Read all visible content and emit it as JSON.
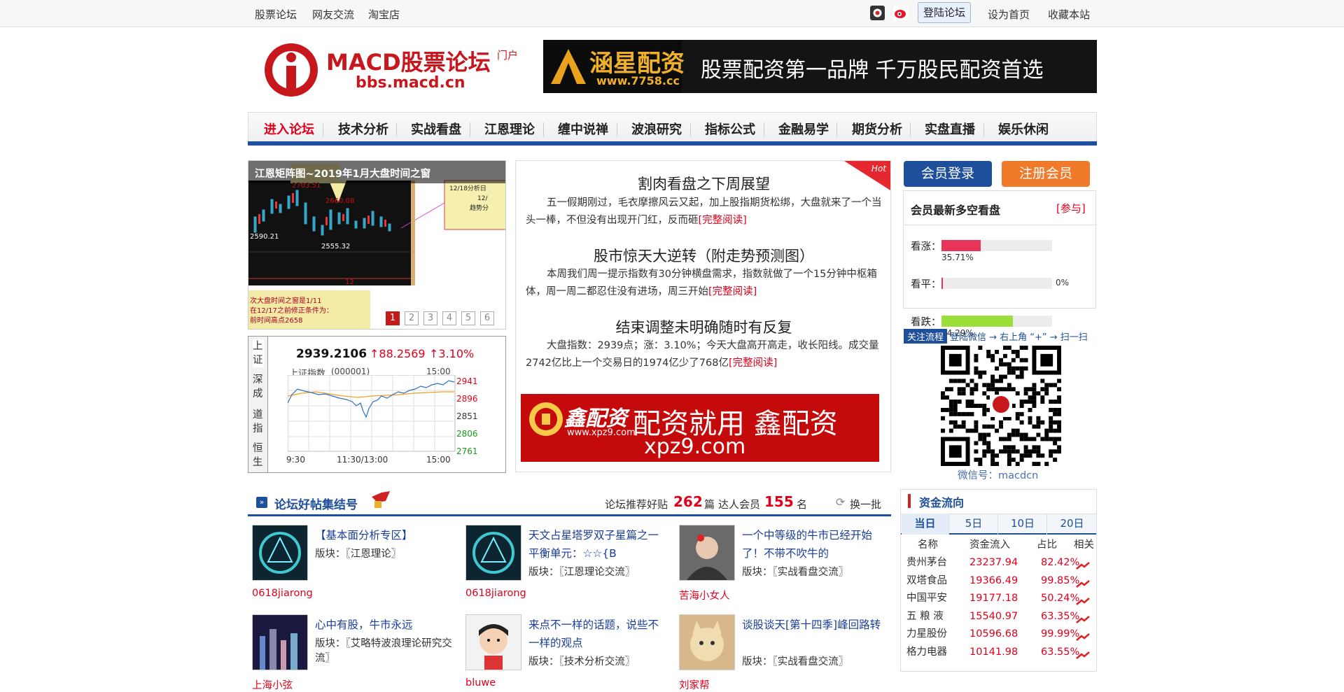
{
  "topbar": {
    "links": [
      "股票论坛",
      "网友交流",
      "淘宝店"
    ],
    "login": "登陆论坛",
    "set_home": "设为首页",
    "bookmark": "收藏本站"
  },
  "logo": {
    "title": "MACD股票论坛",
    "suffix": "门户",
    "url": "bbs.macd.cn"
  },
  "banner_top": {
    "brand": "涵星配资",
    "url": "www.7758.cc",
    "slogan": "股票配资第一品牌 千万股民配资首选"
  },
  "nav": [
    "进入论坛",
    "技术分析",
    "实战看盘",
    "江恩理论",
    "缠中说禅",
    "波浪研究",
    "指标公式",
    "金融易学",
    "期货分析",
    "实盘直播",
    "娱乐休闲"
  ],
  "slide": {
    "caption": "江恩矩阵图~2019年1月大盘时间之窗",
    "chart_labels": [
      "2703.51",
      "2660.08",
      "2590.21",
      "2555.32",
      "12",
      "12/18分析日",
      "趋势分",
      "次大盘时间之窗是1/11",
      "在12/17之前修正条件为：",
      "前时间高点2658"
    ],
    "pages": [
      "1",
      "2",
      "3",
      "4",
      "5",
      "6"
    ]
  },
  "index": {
    "tabs": [
      "上证",
      "深成",
      "道指",
      "恒生"
    ],
    "value": "2939.2106",
    "change": "↑88.2569",
    "pct": "↑3.10%",
    "name": "上证指数",
    "code": "(000001)",
    "time_label": "15:00",
    "y_ticks": [
      "2941",
      "2896",
      "2851",
      "2806",
      "2761"
    ],
    "x_ticks": [
      "9:30",
      "11:30/13:00",
      "15:00"
    ]
  },
  "articles": [
    {
      "title": "割肉看盘之下周展望",
      "body": "五一假期刚过，毛衣摩擦风云又起，加上股指期货松绑，大盘就来了一个当头一棒，不但没有出现开门红，反而砸",
      "more": "[完整阅读]"
    },
    {
      "title": "股市惊天大逆转（附走势预测图）",
      "body": "本周我们周一提示指数有30分钟横盘需求，指数就做了一个15分钟中枢箱体，周一周二都忍住没有进场，周三开始",
      "more": "[完整阅读]"
    },
    {
      "title": "结束调整未明确随时有反复",
      "body": "大盘指数：2939点；涨：3.10%；今天大盘高开高走，收长阳线。成交量2742亿比上一个交易日的1974亿少了768亿",
      "more": "[完整阅读]"
    }
  ],
  "hot_label": "Hot",
  "ad2": {
    "brand": "鑫配资",
    "url_small": "www.xpz9.com",
    "slogan": "配资就用 鑫配资",
    "url": "xpz9.com"
  },
  "member": {
    "login": "会员登录",
    "register": "注册会员"
  },
  "vote": {
    "title": "会员最新多空看盘",
    "join": "[参与]",
    "items": [
      {
        "label": "看涨：",
        "pct": "35.71%",
        "value": 35.71,
        "color": "#e8335a"
      },
      {
        "label": "看平：",
        "pct": "0%",
        "value": 0,
        "color": "#e8335a"
      },
      {
        "label": "看跌：",
        "pct": "64.29%",
        "value": 64.29,
        "color": "#9be03a"
      }
    ]
  },
  "follow": {
    "tag": "关注流程",
    "text": "登陆微信 → 右上角 “+” → 扫一扫",
    "wechat": "微信号：macdcn"
  },
  "section": {
    "title": "论坛好帖集结号",
    "rec_label": "论坛推荐好贴",
    "rec_count": "262",
    "rec_unit": "篇",
    "member_label": "达人会员",
    "member_count": "155",
    "member_unit": "名",
    "refresh": "换一批"
  },
  "posts": [
    {
      "title": "【基本面分析专区】",
      "section": "版块：〖江恩理论〗",
      "user": "0618jiarong"
    },
    {
      "title": "天文占星塔罗双子星篇之一平衡单元：☆☆{B",
      "section": "版块：〖江恩理论交流〗",
      "user": "0618jiarong"
    },
    {
      "title": "一个中等级的牛市已经开始了！不带不吹牛的",
      "section": "版块：〖实战看盘交流〗",
      "user": "苦海小女人"
    },
    {
      "title": "心中有股，牛市永远",
      "section": "版块：〖艾略特波浪理论研究交流〗",
      "user": "上海小弦"
    },
    {
      "title": "来点不一样的话题，说些不一样的观点",
      "section": "版块：〖技术分析交流〗",
      "user": "bluwe"
    },
    {
      "title": "谈股谈天[第十四季]峰回路转",
      "section": "版块：〖实战看盘交流〗",
      "user": "刘家帮"
    }
  ],
  "fund": {
    "title": "资金流向",
    "tabs": [
      "当日",
      "5日",
      "10日",
      "20日"
    ],
    "headers": [
      "名称",
      "资金流入",
      "占比",
      "相关"
    ],
    "rows": [
      [
        "贵州茅台",
        "23237.94",
        "82.42%"
      ],
      [
        "双塔食品",
        "19366.49",
        "99.85%"
      ],
      [
        "中国平安",
        "19177.18",
        "50.24%"
      ],
      [
        "五 粮 液",
        "15540.97",
        "63.35%"
      ],
      [
        "力星股份",
        "10596.68",
        "99.99%"
      ],
      [
        "格力电器",
        "10141.98",
        "63.55%"
      ]
    ]
  }
}
